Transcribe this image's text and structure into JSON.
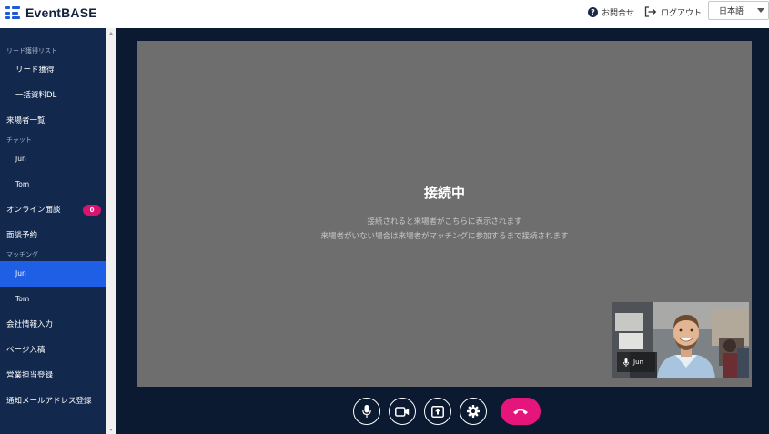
{
  "header": {
    "logo_text": "EventBASE",
    "help_label": "お問合せ",
    "logout_label": "ログアウト",
    "language": "日本語"
  },
  "sidebar": {
    "sections": {
      "leads": "リード獲得リスト",
      "chat": "チャット",
      "matching": "マッチング"
    },
    "items": {
      "lead_acquisition": "リード獲得",
      "bulk_download": "一括資料DL",
      "visitor_list": "来場者一覧",
      "chat_jun": "Jun",
      "chat_tom": "Tom",
      "online_interview": "オンライン面談",
      "online_interview_badge": "0",
      "interview_booking": "面談予約",
      "matching_jun": "Jun",
      "matching_tom": "Tom",
      "company_info": "会社情報入力",
      "page_entry": "ページ入稿",
      "sales_rep": "営業担当登録",
      "notify_email": "通知メールアドレス登録"
    }
  },
  "call": {
    "status_title": "接続中",
    "message_line1": "接続されると来場者がこちらに表示されます",
    "message_line2": "来場者がいない場合は来場者がマッチングに参加するまで接続されます",
    "self_name": "Jun"
  },
  "colors": {
    "sidebar_bg": "#12284d",
    "active_item": "#1f5fe6",
    "badge": "#d8146f",
    "main_bg": "#0b1a30",
    "stage_bg": "#6e6e6e",
    "end_call": "#e5157c"
  },
  "icons": {
    "help": "question-circle-icon",
    "logout": "logout-icon",
    "mic": "microphone-icon",
    "camera": "video-camera-icon",
    "share": "screen-share-icon",
    "settings": "gear-icon",
    "hangup": "phone-hangup-icon"
  }
}
